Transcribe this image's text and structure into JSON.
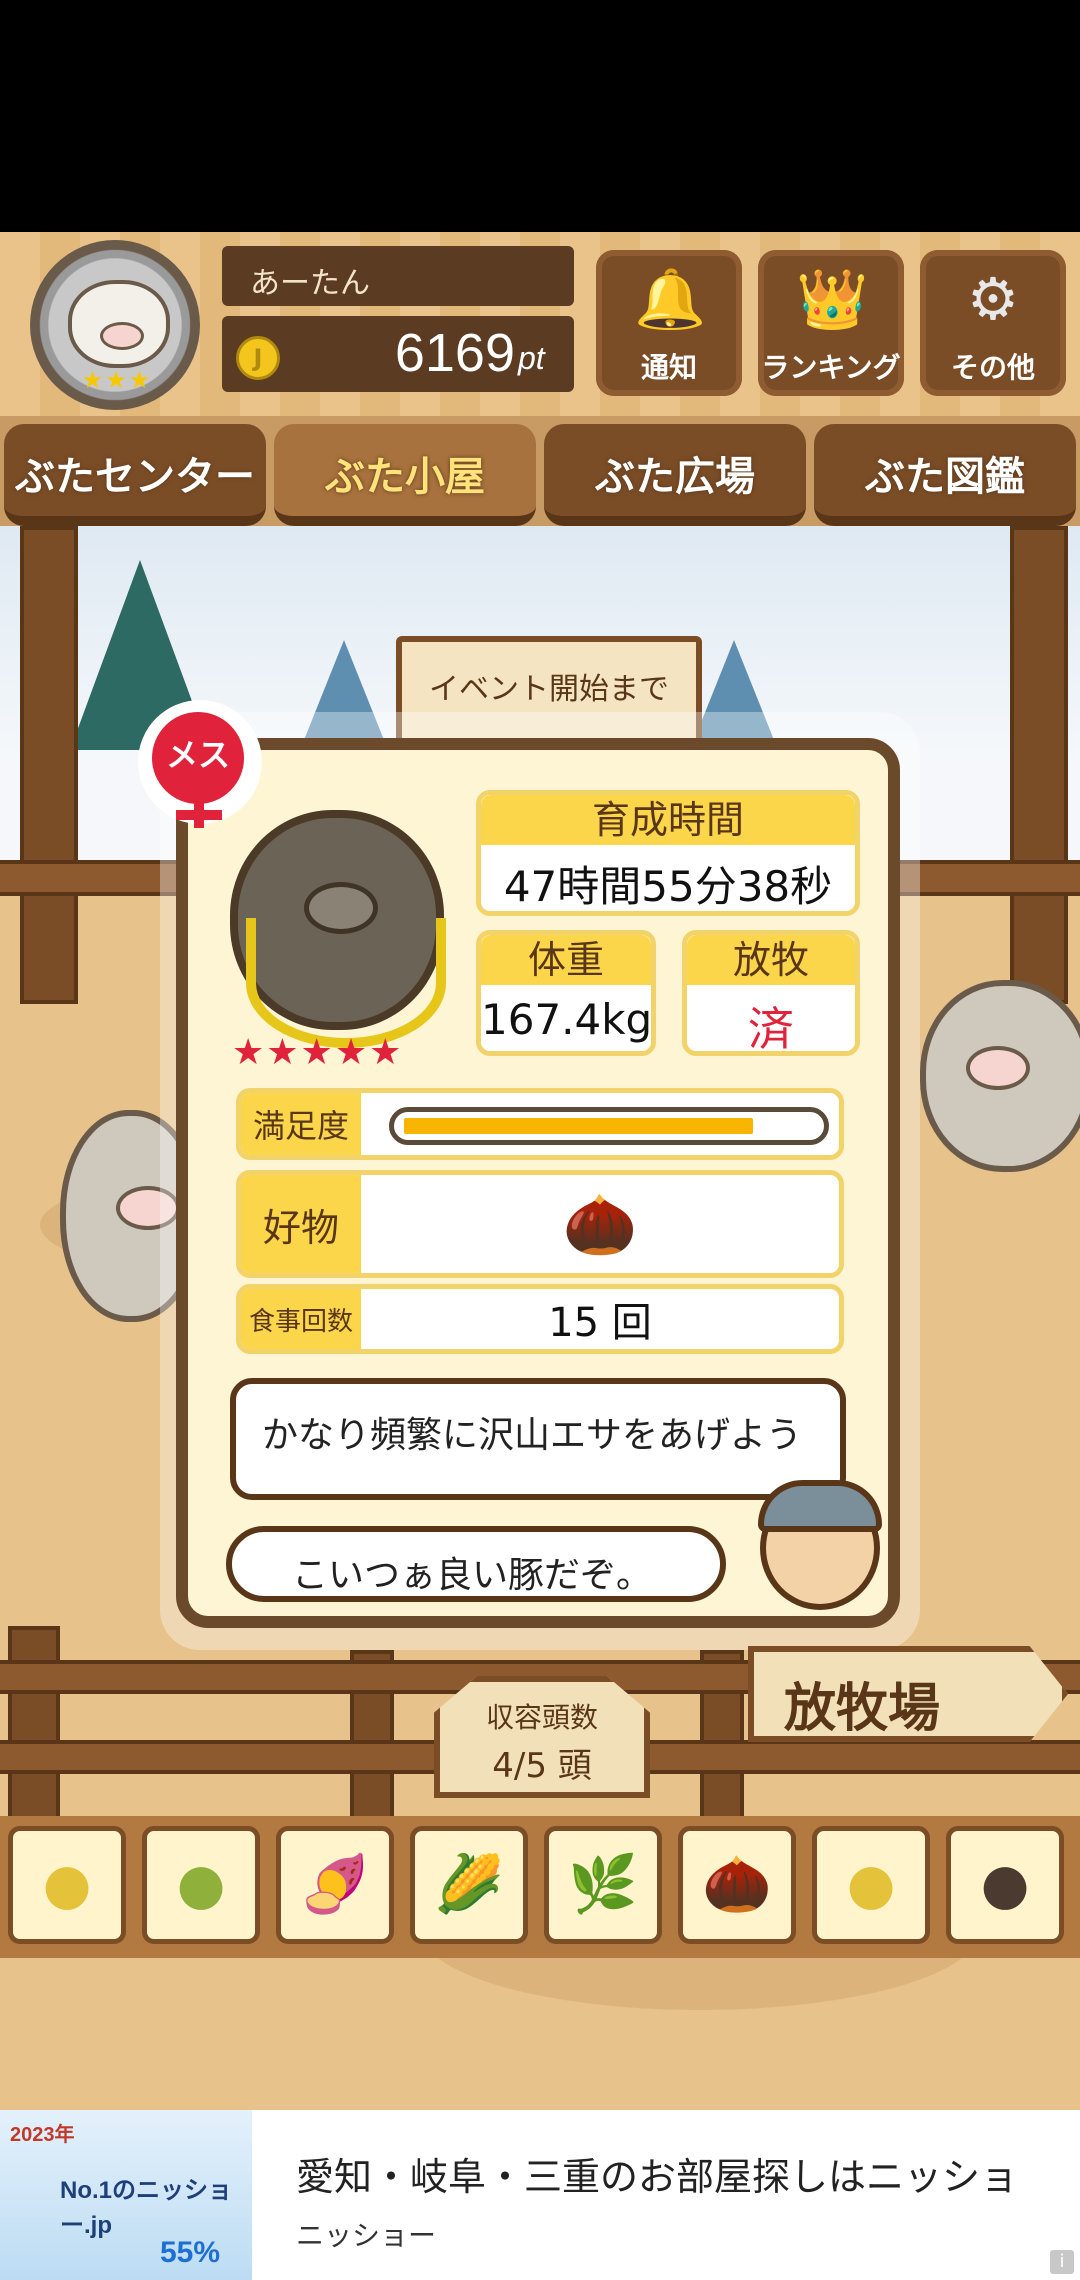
{
  "header": {
    "player_name": "あーたん",
    "points_value": "6169",
    "points_unit": "pt",
    "buttons": [
      {
        "label": "通知",
        "icon": "bell-icon",
        "glyph": "🔔"
      },
      {
        "label": "ランキング",
        "icon": "crown-icon",
        "glyph": "👑"
      },
      {
        "label": "その他",
        "icon": "gear-icon",
        "glyph": "⚙"
      }
    ]
  },
  "tabs": [
    {
      "label": "ぶたセンター",
      "active": false
    },
    {
      "label": "ぶた小屋",
      "active": true
    },
    {
      "label": "ぶた広場",
      "active": false
    },
    {
      "label": "ぶた図鑑",
      "active": false
    }
  ],
  "event_sign": "イベント開始まで",
  "pig_card": {
    "gender_label": "メス",
    "rating_stars": "★★★★★",
    "growth_time_label": "育成時間",
    "growth_time_value": "47時間55分38秒",
    "weight_label": "体重",
    "weight_value": "167.4kg",
    "grazing_label": "放牧",
    "grazing_value": "済",
    "satisfaction_label": "満足度",
    "satisfaction_level": 0.85,
    "favorite_label": "好物",
    "favorite_icon": "acorn-icon",
    "favorite_glyph": "🌰",
    "meals_label": "食事回数",
    "meals_value": "15 回",
    "advice_text": "かなり頻繁に沢山エサをあげよう",
    "comment_text": "こいつぁ良い豚だぞ。"
  },
  "grazing_sign": "放牧場",
  "capacity": {
    "label": "収容頭数",
    "value": "4/5 頭"
  },
  "food_items": [
    {
      "name": "soybeans-icon",
      "glyph": "●"
    },
    {
      "name": "mixed-beans-icon",
      "glyph": "●"
    },
    {
      "name": "sweet-potato-icon",
      "glyph": "🍠"
    },
    {
      "name": "corn-icon",
      "glyph": "🌽"
    },
    {
      "name": "nuts-leaves-icon",
      "glyph": "🌿"
    },
    {
      "name": "acorn-icon",
      "glyph": "🌰"
    },
    {
      "name": "corn-bowl-icon",
      "glyph": "●"
    },
    {
      "name": "dark-pellets-icon",
      "glyph": "●"
    }
  ],
  "ad": {
    "title": "愛知・岐阜・三重のお部屋探しはニッショ",
    "subtitle": "ニッショー",
    "thumb_line1": "2023年",
    "thumb_brand": "No.1のニッショー.jp",
    "thumb_discount": "55%",
    "info_glyph": "i"
  },
  "colors": {
    "wood_dark": "#7a4d27",
    "card_bg": "#fdf5d3",
    "label_yellow": "#fbd64a",
    "female_red": "#e0233a",
    "meter_fill": "#f7b400"
  }
}
